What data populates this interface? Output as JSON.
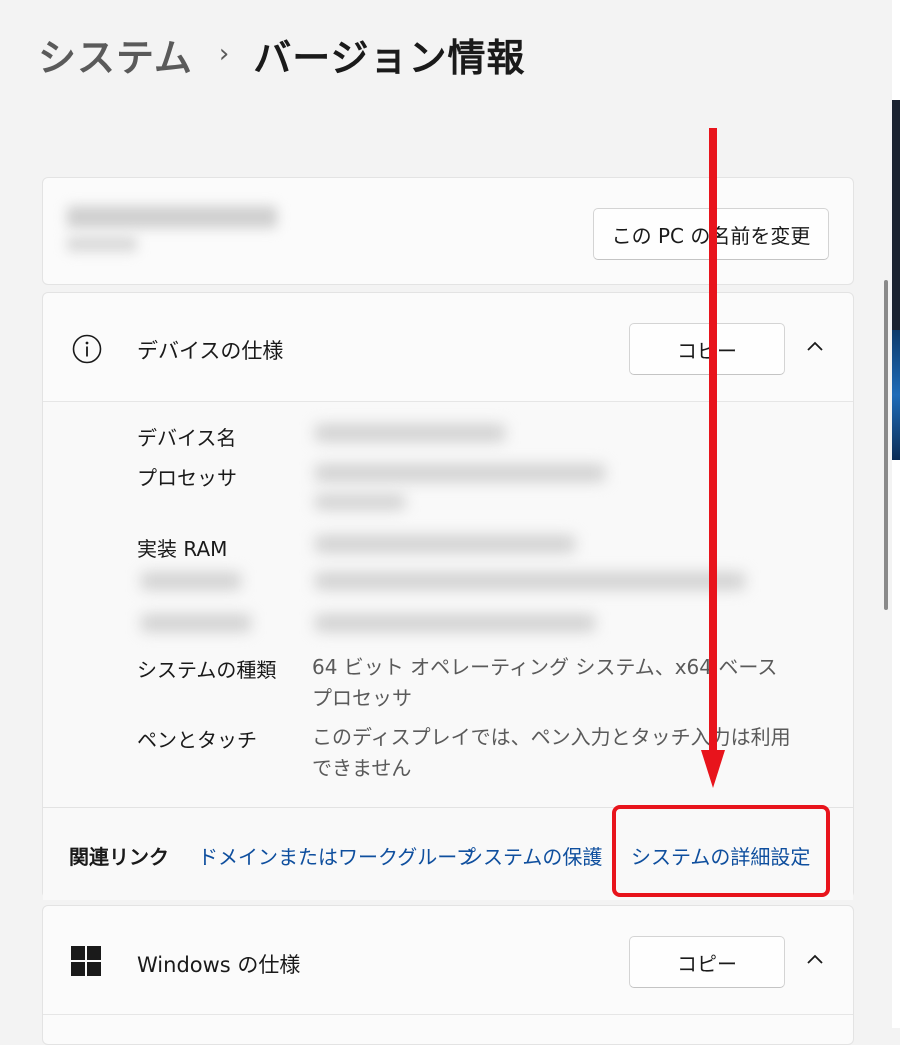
{
  "breadcrumb": {
    "parent": "システム",
    "separator": "›",
    "current": "バージョン情報"
  },
  "pc_card": {
    "rename_button": "この PC の名前を変更"
  },
  "device_specs": {
    "icon": "info-icon",
    "title": "デバイスの仕様",
    "copy_button": "コピー",
    "rows": [
      {
        "label": "デバイス名"
      },
      {
        "label": "プロセッサ"
      },
      {
        "label": "実装 RAM"
      },
      {
        "label": "システムの種類",
        "value": "64 ビット オペレーティング システム、x64 ベース プロセッサ"
      },
      {
        "label": "ペンとタッチ",
        "value": "このディスプレイでは、ペン入力とタッチ入力は利用できません"
      }
    ]
  },
  "related_links": {
    "label": "関連リンク",
    "links": [
      "ドメインまたはワークグループ",
      "システムの保護",
      "システムの詳細設定"
    ]
  },
  "windows_specs": {
    "icon": "windows-logo-icon",
    "title": "Windows の仕様",
    "copy_button": "コピー"
  },
  "colors": {
    "link": "#0f4f9e",
    "annotation": "#e8141c",
    "background": "#f3f3f3"
  }
}
